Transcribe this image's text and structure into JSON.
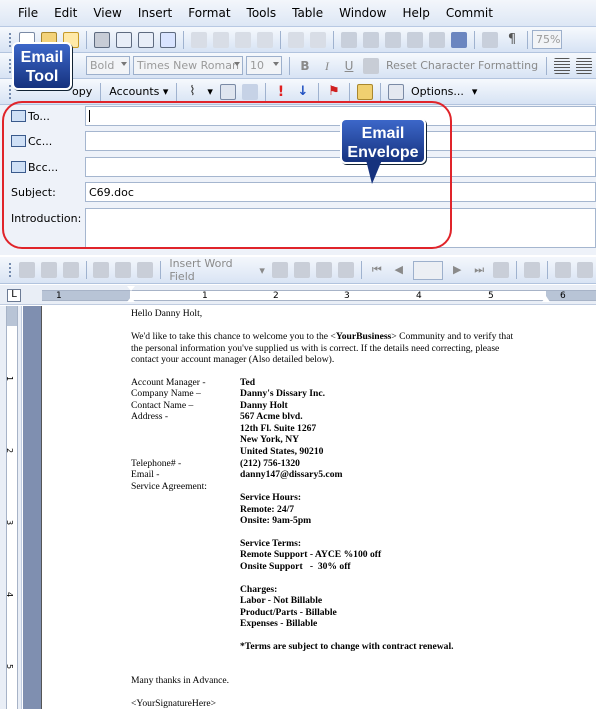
{
  "menu": {
    "items": [
      "File",
      "Edit",
      "View",
      "Insert",
      "Format",
      "Tools",
      "Table",
      "Window",
      "Help",
      "Commit"
    ],
    "underline": [
      "F",
      "E",
      "V",
      "I",
      "o",
      "T",
      "a",
      "W",
      "H",
      "C"
    ]
  },
  "toolbar1": {
    "zoom": "75%"
  },
  "toolbar2": {
    "style": "Bold",
    "font": "Times New Roman",
    "size": "10",
    "reset_label": "Reset Character Formatting"
  },
  "toolbar_email": {
    "copy_label": "opy",
    "accounts_label": "Accounts",
    "options_label": "Options..."
  },
  "envelope": {
    "to_label": "To...",
    "cc_label": "Cc...",
    "bcc_label": "Bcc...",
    "subject_label": "Subject:",
    "subject_value": "C69.doc",
    "intro_label": "Introduction:"
  },
  "callouts": {
    "email_tool": "Email Tool",
    "email_envelope": "Email Envelope"
  },
  "toolbar3": {
    "insert_word_field": "Insert Word Field"
  },
  "ruler": {
    "h_numbers": [
      "1",
      "1",
      "2",
      "3",
      "4",
      "5",
      "6"
    ],
    "v_numbers": [
      "1",
      "2",
      "3",
      "4",
      "5"
    ]
  },
  "document": {
    "greeting": "Hello Danny Holt,",
    "intro_line1_a": "We'd like to take this chance to welcome you to the <",
    "intro_line1_b": "YourBusiness",
    "intro_line1_c": "> Community and to verify that",
    "intro_line2": "the personal information you've supplied us with is correct.  If the details need correcting, please",
    "intro_line3": "contact your account manager (Also detailed below).",
    "fields": [
      {
        "label": "Account Manager -",
        "value": "Ted"
      },
      {
        "label": "Company Name –",
        "value": "Danny's Dissary Inc."
      },
      {
        "label": "Contact Name –",
        "value": "Danny Holt"
      },
      {
        "label": "Address -",
        "value": "567 Acme blvd."
      }
    ],
    "address_lines": [
      "12th Fl. Suite 1267",
      "New York, NY",
      "United States, 90210"
    ],
    "telephone_label": "Telephone# -",
    "telephone_value": "(212) 756-1320",
    "email_label": "Email -",
    "email_value": "danny147@dissary5.com",
    "service_label": "Service Agreement:",
    "service_hours_head": "Service Hours:",
    "remote_hours": "Remote: 24/7",
    "onsite_hours": "Onsite: 9am-5pm",
    "service_terms_head": "Service Terms:",
    "remote_support": "Remote Support - AYCE %100 off",
    "onsite_support": "Onsite Support   -  30% off",
    "charges_head": "Charges:",
    "labor": "Labor - Not Billable",
    "product": "Product/Parts - Billable",
    "expenses": "Expenses - Billable",
    "terms_note": "*Terms are subject to change with contract renewal.",
    "thanks": "Many thanks in Advance.",
    "signature": "<YourSignatureHere>"
  }
}
